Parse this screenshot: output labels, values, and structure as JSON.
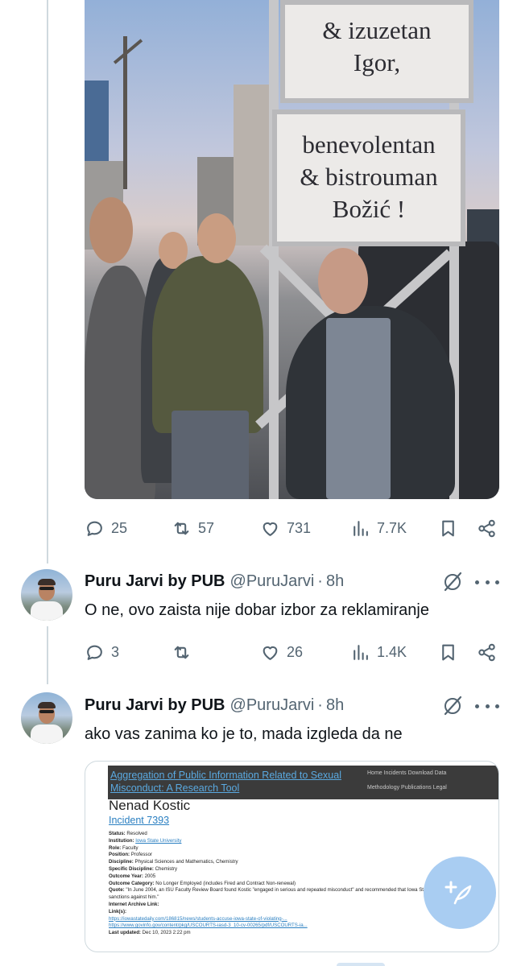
{
  "post1": {
    "sign": {
      "lines_top": [
        "& izuzetan",
        "Igor,"
      ],
      "lines_bottom": [
        "benevolentan",
        "& bistrouman",
        "Božić !"
      ]
    },
    "stats": {
      "replies": "25",
      "reposts": "57",
      "likes": "731",
      "views": "7.7K"
    }
  },
  "reply1": {
    "name": "Puru Jarvi by PUB",
    "handle": "@PuruJarvi",
    "separator": "·",
    "time": "8h",
    "text": "O ne, ovo zaista nije dobar izbor za reklamiranje",
    "stats": {
      "replies": "3",
      "reposts": "",
      "likes": "26",
      "views": "1.4K"
    }
  },
  "reply2": {
    "name": "Puru Jarvi by PUB",
    "handle": "@PuruJarvi",
    "separator": "·",
    "time": "8h",
    "text": "ako vas zanima ko je to, mada izgleda da ne",
    "card": {
      "site_title": "Aggregation of Public Information Related to Sexual Misconduct: A Research Tool",
      "nav_row1": "Home   Incidents   Download Data",
      "nav_row2": "Methodology   Publications   Legal",
      "person": "Nenad Kostic",
      "incident": "Incident 7393",
      "fields": [
        {
          "label": "Status:",
          "value": "Resolved"
        },
        {
          "label": "Institution:",
          "value": "Iowa State University"
        },
        {
          "label": "Role:",
          "value": "Faculty"
        },
        {
          "label": "Position:",
          "value": "Professor"
        },
        {
          "label": "Discipline:",
          "value": "Physical Sciences and Mathematics, Chemistry"
        },
        {
          "label": "Specific Discipline:",
          "value": "Chemistry"
        },
        {
          "label": "Outcome Year:",
          "value": "2005"
        },
        {
          "label": "Outcome Category:",
          "value": "No Longer Employed (includes Fired and Contract Non-renewal)"
        }
      ],
      "quote_label": "Quote:",
      "quote": "\"In June 2004, an ISU Faculty Review Board found Kostic \"engaged in serious and repeated misconduct\" and recommended that Iowa State proceed with major sanctions against him.\"",
      "archive_label": "Internet Archive Link:",
      "links_label": "Link(s):",
      "link1": "https://iowastatedaily.com/186815/news/students-accuse-iowa-state-of-violating-...",
      "link2": "https://www.govinfo.gov/content/pkg/USCOURTS-iasd-3_10-cv-00265/pdf/USCOURTS-ia...",
      "updated_label": "Last updated:",
      "updated": "Dec 10, 2023 2:22 pm"
    }
  },
  "icons": {
    "reply": "reply-icon",
    "repost": "repost-icon",
    "like": "heart-icon",
    "views": "views-icon",
    "bookmark": "bookmark-icon",
    "share": "share-icon",
    "grok": "grok-icon",
    "more": "more-icon",
    "compose": "compose-icon"
  }
}
